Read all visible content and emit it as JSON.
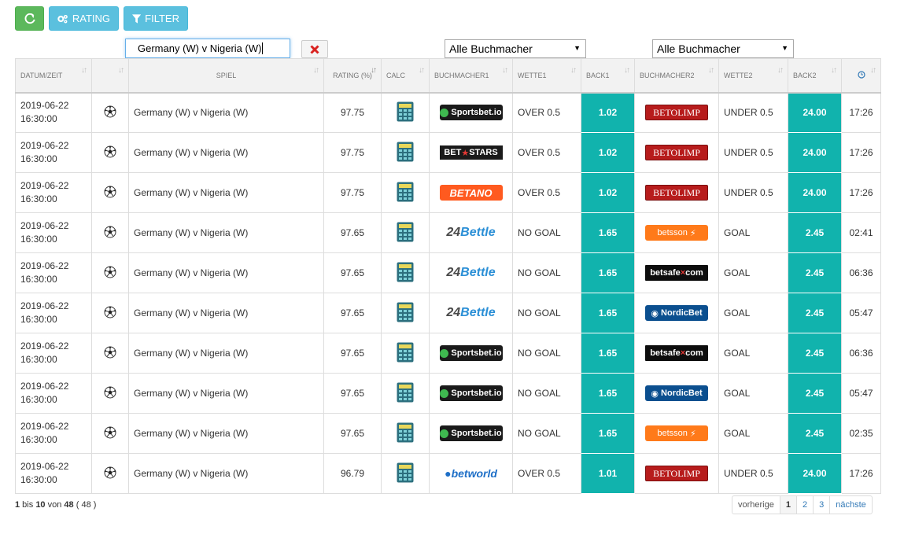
{
  "toolbar": {
    "refresh_icon": "refresh-icon",
    "rating_label": "RATING",
    "filter_label": "FILTER",
    "colors": {
      "green": "#5cb85c",
      "blue": "#5bc0de"
    }
  },
  "filters": {
    "search_value": "Germany (W) v Nigeria (W)",
    "bookmaker1_select": "Alle Buchmacher",
    "bookmaker2_select": "Alle Buchmacher"
  },
  "columns": [
    "DATUM/ZEIT",
    "",
    "SPIEL",
    "RATING (%)",
    "CALC",
    "BUCHMACHER1",
    "WETTE1",
    "BACK1",
    "BUCHMACHER2",
    "WETTE2",
    "BACK2",
    ""
  ],
  "odds_color": "#11b3ad",
  "rows": [
    {
      "date": "2019-06-22",
      "time": "16:30:00",
      "match": "Germany (W) v Nigeria (W)",
      "rating": "97.75",
      "bookmaker1": "sportsbet",
      "bet1": "OVER 0.5",
      "back1": "1.02",
      "bookmaker2": "betolimp",
      "bet2": "UNDER 0.5",
      "back2": "24.00",
      "age": "17:26"
    },
    {
      "date": "2019-06-22",
      "time": "16:30:00",
      "match": "Germany (W) v Nigeria (W)",
      "rating": "97.75",
      "bookmaker1": "betstars",
      "bet1": "OVER 0.5",
      "back1": "1.02",
      "bookmaker2": "betolimp",
      "bet2": "UNDER 0.5",
      "back2": "24.00",
      "age": "17:26"
    },
    {
      "date": "2019-06-22",
      "time": "16:30:00",
      "match": "Germany (W) v Nigeria (W)",
      "rating": "97.75",
      "bookmaker1": "betano",
      "bet1": "OVER 0.5",
      "back1": "1.02",
      "bookmaker2": "betolimp",
      "bet2": "UNDER 0.5",
      "back2": "24.00",
      "age": "17:26"
    },
    {
      "date": "2019-06-22",
      "time": "16:30:00",
      "match": "Germany (W) v Nigeria (W)",
      "rating": "97.65",
      "bookmaker1": "24bettle",
      "bet1": "NO GOAL",
      "back1": "1.65",
      "bookmaker2": "betsson",
      "bet2": "GOAL",
      "back2": "2.45",
      "age": "02:41"
    },
    {
      "date": "2019-06-22",
      "time": "16:30:00",
      "match": "Germany (W) v Nigeria (W)",
      "rating": "97.65",
      "bookmaker1": "24bettle",
      "bet1": "NO GOAL",
      "back1": "1.65",
      "bookmaker2": "betsafe",
      "bet2": "GOAL",
      "back2": "2.45",
      "age": "06:36"
    },
    {
      "date": "2019-06-22",
      "time": "16:30:00",
      "match": "Germany (W) v Nigeria (W)",
      "rating": "97.65",
      "bookmaker1": "24bettle",
      "bet1": "NO GOAL",
      "back1": "1.65",
      "bookmaker2": "nordicbet",
      "bet2": "GOAL",
      "back2": "2.45",
      "age": "05:47"
    },
    {
      "date": "2019-06-22",
      "time": "16:30:00",
      "match": "Germany (W) v Nigeria (W)",
      "rating": "97.65",
      "bookmaker1": "sportsbet",
      "bet1": "NO GOAL",
      "back1": "1.65",
      "bookmaker2": "betsafe",
      "bet2": "GOAL",
      "back2": "2.45",
      "age": "06:36"
    },
    {
      "date": "2019-06-22",
      "time": "16:30:00",
      "match": "Germany (W) v Nigeria (W)",
      "rating": "97.65",
      "bookmaker1": "sportsbet",
      "bet1": "NO GOAL",
      "back1": "1.65",
      "bookmaker2": "nordicbet",
      "bet2": "GOAL",
      "back2": "2.45",
      "age": "05:47"
    },
    {
      "date": "2019-06-22",
      "time": "16:30:00",
      "match": "Germany (W) v Nigeria (W)",
      "rating": "97.65",
      "bookmaker1": "sportsbet",
      "bet1": "NO GOAL",
      "back1": "1.65",
      "bookmaker2": "betsson",
      "bet2": "GOAL",
      "back2": "2.45",
      "age": "02:35"
    },
    {
      "date": "2019-06-22",
      "time": "16:30:00",
      "match": "Germany (W) v Nigeria (W)",
      "rating": "96.79",
      "bookmaker1": "betworld",
      "bet1": "OVER 0.5",
      "back1": "1.01",
      "bookmaker2": "betolimp",
      "bet2": "UNDER 0.5",
      "back2": "24.00",
      "age": "17:26"
    }
  ],
  "bookmakers": {
    "sportsbet": {
      "text": "Sportsbet.io"
    },
    "betstars": {
      "text_a": "BET",
      "text_b": "STARS"
    },
    "betano": {
      "text": "BETANO"
    },
    "24bettle": {
      "text_a": "24",
      "text_b": "Bettle"
    },
    "betolimp": {
      "text": "BETOLIMP"
    },
    "betsson": {
      "text": "betsson"
    },
    "betsafe": {
      "text_a": "betsafe",
      "text_b": "com"
    },
    "nordicbet": {
      "text": "NordicBet"
    },
    "betworld": {
      "text": "betworld"
    }
  },
  "footer": {
    "range_from": "1",
    "range_to": "10",
    "total": "48",
    "total_paren": "48",
    "pager": {
      "prev": "vorherige",
      "pages": [
        "1",
        "2",
        "3"
      ],
      "next": "nächste",
      "active": "1"
    }
  }
}
